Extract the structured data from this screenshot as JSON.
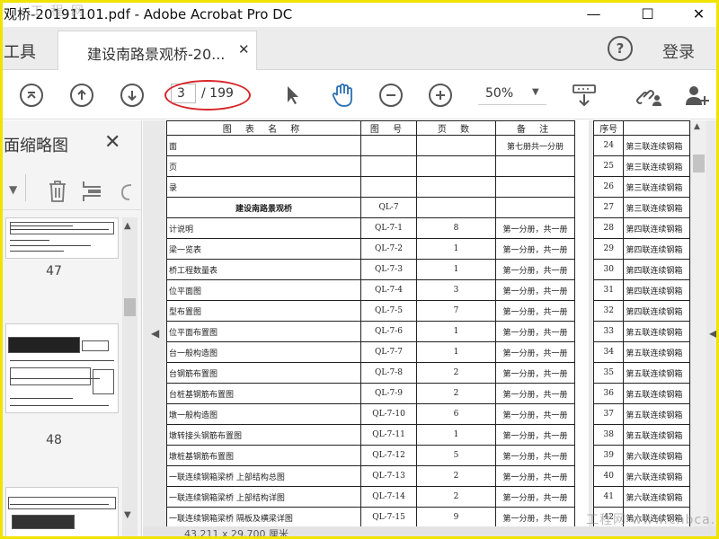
{
  "window": {
    "title": "观桥-20191101.pdf - Adobe Acrobat Pro DC",
    "watermark_top": "工 程 网",
    "minimize": "—",
    "maximize": "☐",
    "close": "✕"
  },
  "tabbar": {
    "tools_label": "工具",
    "active_tab": "建设南路景观桥-20...",
    "tab_close": "✕",
    "help": "?",
    "login": "登录"
  },
  "toolbar": {
    "page_current": "3",
    "page_total": "/ 199",
    "zoom": "50%",
    "icons": [
      "first-page-icon",
      "prev-page-icon",
      "next-page-icon",
      "select-cursor-icon",
      "hand-tool-icon",
      "zoom-out-icon",
      "zoom-in-icon",
      "keyboard-scroll-icon",
      "link-icon",
      "add-user-icon"
    ]
  },
  "sidebar": {
    "title": "面缩略图",
    "close": "✕",
    "thumbnails": [
      {
        "number": "47"
      },
      {
        "number": "48"
      }
    ]
  },
  "document": {
    "headers": [
      "图 表 名 称",
      "图 号",
      "页 数",
      "备 注",
      "序号"
    ],
    "rows": [
      {
        "name": "面",
        "no": "",
        "pages": "",
        "note": "第七册共一分册",
        "seq": "24",
        "name2": "第三联连续钢箱"
      },
      {
        "name": "页",
        "no": "",
        "pages": "",
        "note": "",
        "seq": "25",
        "name2": "第三联连续钢箱"
      },
      {
        "name": "录",
        "no": "",
        "pages": "",
        "note": "",
        "seq": "26",
        "name2": "第三联连续钢箱"
      },
      {
        "name": "建设南路景观桥",
        "no": "QL-7",
        "pages": "",
        "note": "",
        "seq": "27",
        "name2": "第三联连续钢箱",
        "bold": true
      },
      {
        "name": "计说明",
        "no": "QL-7-1",
        "pages": "8",
        "note": "第一分册，共一册",
        "seq": "28",
        "name2": "第四联连续钢箱"
      },
      {
        "name": "梁一览表",
        "no": "QL-7-2",
        "pages": "1",
        "note": "第一分册，共一册",
        "seq": "29",
        "name2": "第四联连续钢箱"
      },
      {
        "name": "桥工程数量表",
        "no": "QL-7-3",
        "pages": "1",
        "note": "第一分册，共一册",
        "seq": "30",
        "name2": "第四联连续钢箱"
      },
      {
        "name": "位平面图",
        "no": "QL-7-4",
        "pages": "3",
        "note": "第一分册，共一册",
        "seq": "31",
        "name2": "第四联连续钢箱"
      },
      {
        "name": "型布置图",
        "no": "QL-7-5",
        "pages": "7",
        "note": "第一分册，共一册",
        "seq": "32",
        "name2": "第四联连续钢箱"
      },
      {
        "name": "位平面布置图",
        "no": "QL-7-6",
        "pages": "1",
        "note": "第一分册，共一册",
        "seq": "33",
        "name2": "第五联连续钢箱"
      },
      {
        "name": "台一般构造图",
        "no": "QL-7-7",
        "pages": "1",
        "note": "第一分册，共一册",
        "seq": "34",
        "name2": "第五联连续钢箱"
      },
      {
        "name": "台钢筋布置图",
        "no": "QL-7-8",
        "pages": "2",
        "note": "第一分册，共一册",
        "seq": "35",
        "name2": "第五联连续钢箱"
      },
      {
        "name": "台桩基钢筋布置图",
        "no": "QL-7-9",
        "pages": "2",
        "note": "第一分册，共一册",
        "seq": "36",
        "name2": "第五联连续钢箱"
      },
      {
        "name": "墩一般构造图",
        "no": "QL-7-10",
        "pages": "6",
        "note": "第一分册，共一册",
        "seq": "37",
        "name2": "第五联连续钢箱"
      },
      {
        "name": "墩转接头钢筋布置图",
        "no": "QL-7-11",
        "pages": "1",
        "note": "第一分册，共一册",
        "seq": "38",
        "name2": "第五联连续钢箱"
      },
      {
        "name": "墩桩基钢筋布置图",
        "no": "QL-7-12",
        "pages": "5",
        "note": "第一分册，共一册",
        "seq": "39",
        "name2": "第六联连续钢箱"
      },
      {
        "name": "一联连续钢箱梁桥 上部结构总图",
        "no": "QL-7-13",
        "pages": "2",
        "note": "第一分册，共一册",
        "seq": "40",
        "name2": "第六联连续钢箱"
      },
      {
        "name": "一联连续钢箱梁桥 上部结构详图",
        "no": "QL-7-14",
        "pages": "2",
        "note": "第一分册，共一册",
        "seq": "41",
        "name2": "第六联连续钢箱"
      },
      {
        "name": "一联连续钢箱梁桥 隔板及横梁详图",
        "no": "QL-7-15",
        "pages": "9",
        "note": "第一分册，共一册",
        "seq": "42",
        "name2": "第六联连续钢箱"
      }
    ]
  },
  "statusbar": {
    "text": "43.211 x 29.700 厘米"
  },
  "watermark_bottom": "工程网 www.cnbca.com",
  "colors": {
    "frame": "#f2e200",
    "highlight_ellipse": "#d8262a"
  }
}
